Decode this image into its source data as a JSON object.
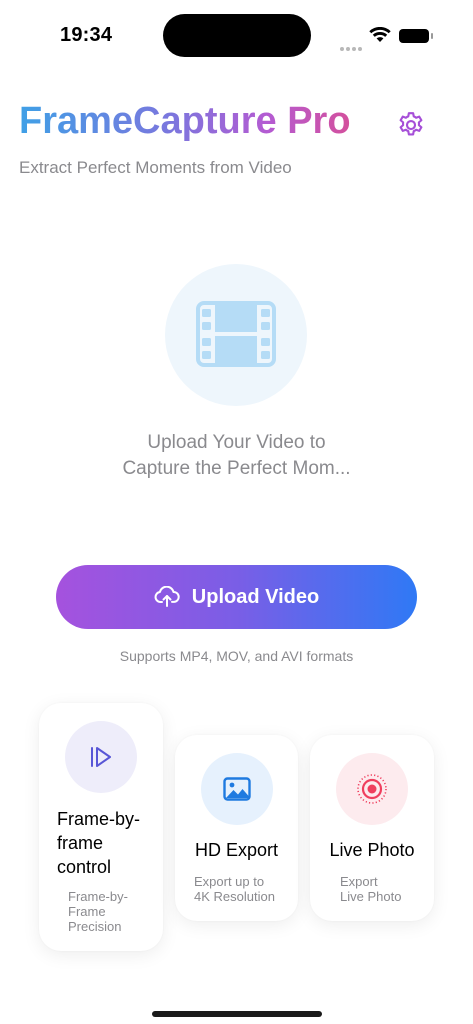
{
  "status_bar": {
    "time": "19:34"
  },
  "header": {
    "title": "FrameCapture Pro",
    "subtitle": "Extract Perfect Moments from Video",
    "settings_icon": "gear-icon"
  },
  "hero": {
    "icon": "film-icon",
    "prompt_line1": "Upload Your Video to",
    "prompt_line2": "Capture the Perfect Mom..."
  },
  "upload": {
    "button_label": "Upload Video",
    "button_icon": "cloud-upload-icon",
    "formats_note": "Supports MP4, MOV, and AVI formats"
  },
  "features": [
    {
      "title_line1": "Frame-by-",
      "title_line2": "frame",
      "title_line3": "control",
      "desc_line1": "Frame-by-",
      "desc_line2": "Frame",
      "desc_line3": "Precision",
      "icon": "play-frame-icon"
    },
    {
      "title": "HD Export",
      "desc_line1": "Export up to",
      "desc_line2": "4K Resolution",
      "icon": "image-icon"
    },
    {
      "title": "Live Photo",
      "desc_line1": "Export",
      "desc_line2": "Live Photo",
      "icon": "live-photo-icon"
    }
  ],
  "colors": {
    "title_gradient": [
      "#3fa0e6",
      "#7a77de",
      "#b45bd2",
      "#d4509c"
    ],
    "button_gradient": [
      "#a552de",
      "#7a5ee6",
      "#2f79f5"
    ],
    "accent_purple": "#a64fd8"
  }
}
